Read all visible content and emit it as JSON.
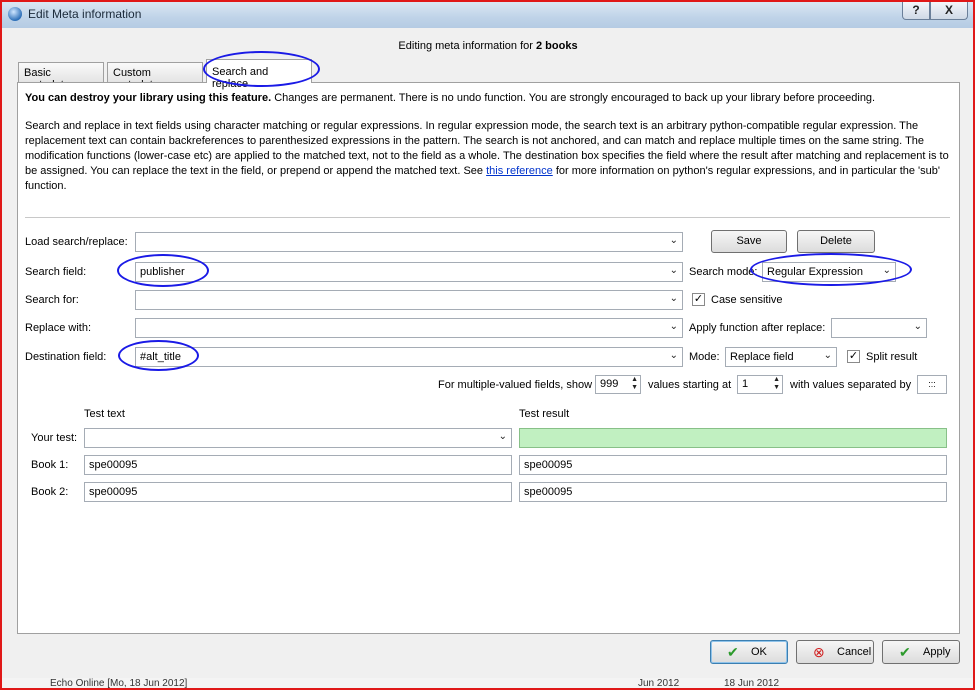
{
  "window": {
    "title": "Edit Meta information",
    "help_label": "?",
    "close_label": "X"
  },
  "heading": {
    "prefix": "Editing meta information for ",
    "bold": "2 books"
  },
  "tabs": [
    {
      "label": "Basic metadata"
    },
    {
      "label": "Custom metadata"
    },
    {
      "label": "Search and replace"
    }
  ],
  "warning": {
    "bold": "You can destroy your library using this feature.",
    "rest": " Changes are permanent. There is no undo function. You are strongly encouraged to back up your library before proceeding."
  },
  "help": {
    "before_link": "Search and replace in text fields using character matching or regular expressions. In regular expression mode, the search text is an arbitrary python-compatible regular expression. The replacement text can contain backreferences to parenthesized expressions in the pattern. The search is not anchored, and can match and replace multiple times on the same string. The modification functions (lower-case etc) are applied to the matched text, not to the field as a whole. The destination box specifies the field where the result after matching and replacement is to be assigned. You can replace the text in the field, or prepend or append the matched text. See ",
    "link": "this reference",
    "after_link": " for more information on python's regular expressions, and in particular the 'sub' function."
  },
  "form": {
    "load_label": "Load search/replace:",
    "load_value": "",
    "save_label": "Save",
    "delete_label": "Delete",
    "search_field_label": "Search field:",
    "search_field_value": "publisher",
    "search_mode_label": "Search mode:",
    "search_mode_value": "Regular Expression",
    "search_for_label": "Search for:",
    "search_for_value": "",
    "case_sensitive_label": "Case sensitive",
    "case_sensitive_checked": "✓",
    "replace_with_label": "Replace with:",
    "replace_with_value": "",
    "apply_function_label": "Apply function after replace:",
    "apply_function_value": "",
    "destination_label": "Destination field:",
    "destination_value": "#alt_title",
    "mode_label": "Mode:",
    "mode_value": "Replace field",
    "split_result_label": "Split result",
    "split_result_checked": "✓",
    "multi_prefix": "For multiple-valued fields, show",
    "multi_show_value": "999",
    "multi_starting_label": "values starting at",
    "multi_start_value": "1",
    "multi_separated_label": "with values separated by",
    "multi_separator_value": ":::"
  },
  "test": {
    "test_text_header": "Test text",
    "test_result_header": "Test result",
    "your_test_label": "Your test:",
    "your_test_value": "",
    "your_test_result": "",
    "book1_label": "Book 1:",
    "book1_text": "spe00095",
    "book1_result": "spe00095",
    "book2_label": "Book 2:",
    "book2_text": "spe00095",
    "book2_result": "spe00095"
  },
  "buttons": {
    "ok_label": "OK",
    "cancel_label": "Cancel",
    "apply_label": "Apply"
  },
  "background_row": {
    "text": "Echo Online [Mo, 18 Jun 2012]",
    "col2": "Jun 2012",
    "col3": "18 Jun 2012"
  },
  "colors": {
    "annotation": "#1a1ae6",
    "border_highlight": "#e01818",
    "test_result_bg": "#c1f0c1"
  }
}
